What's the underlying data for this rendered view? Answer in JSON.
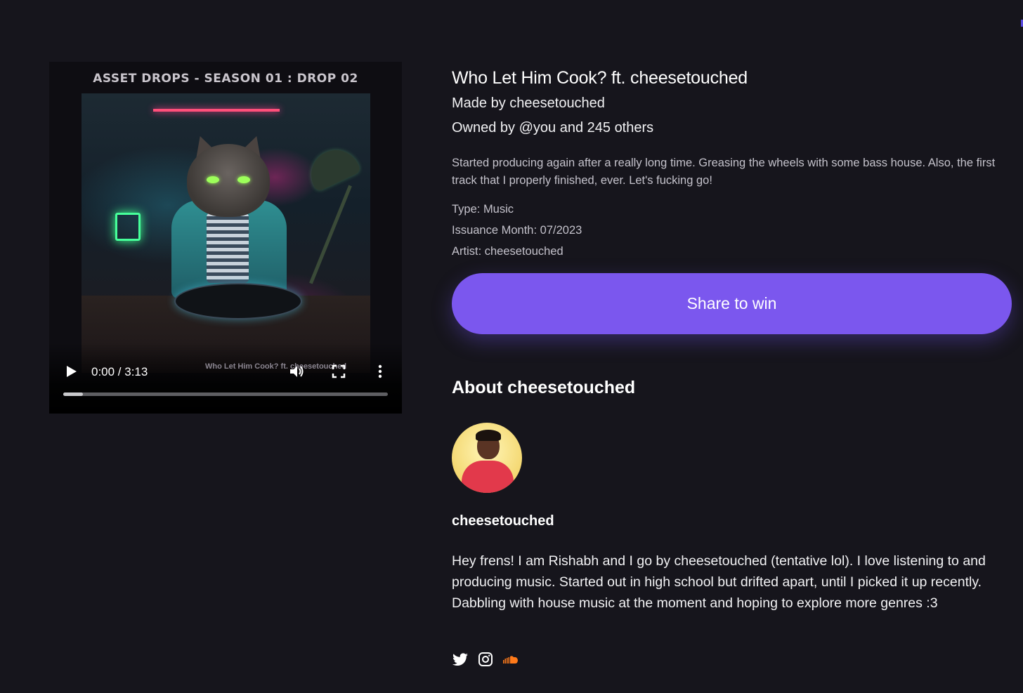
{
  "player": {
    "header": "ASSET DROPS - SEASON 01 : DROP 02",
    "artwork_caption": "Who Let Him Cook? ft. cheesetouched",
    "time": "0:00 / 3:13",
    "progress_fraction": 0.06
  },
  "track": {
    "title": "Who Let Him Cook? ft. cheesetouched",
    "made_by": "Made by cheesetouched",
    "owned_by": "Owned by @you and 245 others",
    "description": "Started producing again after a really long time. Greasing the wheels with some bass house. Also, the first track that I properly finished, ever. Let's fucking go!",
    "type": "Type: Music",
    "issuance": "Issuance Month: 07/2023",
    "artist": "Artist: cheesetouched"
  },
  "share_label": "Share to win",
  "about": {
    "heading": "About cheesetouched",
    "username": "cheesetouched",
    "bio": "Hey frens! I am Rishabh and I go by cheesetouched (tentative lol). I love listening to and producing music. Started out in high school but drifted apart, until I picked it up recently. Dabbling with house music at the moment and hoping to explore more genres :3"
  },
  "socials": [
    "twitter-icon",
    "instagram-icon",
    "soundcloud-icon"
  ],
  "colors": {
    "background": "#16151c",
    "accent": "#7b57ee",
    "soundcloud": "#ff7a1a"
  }
}
